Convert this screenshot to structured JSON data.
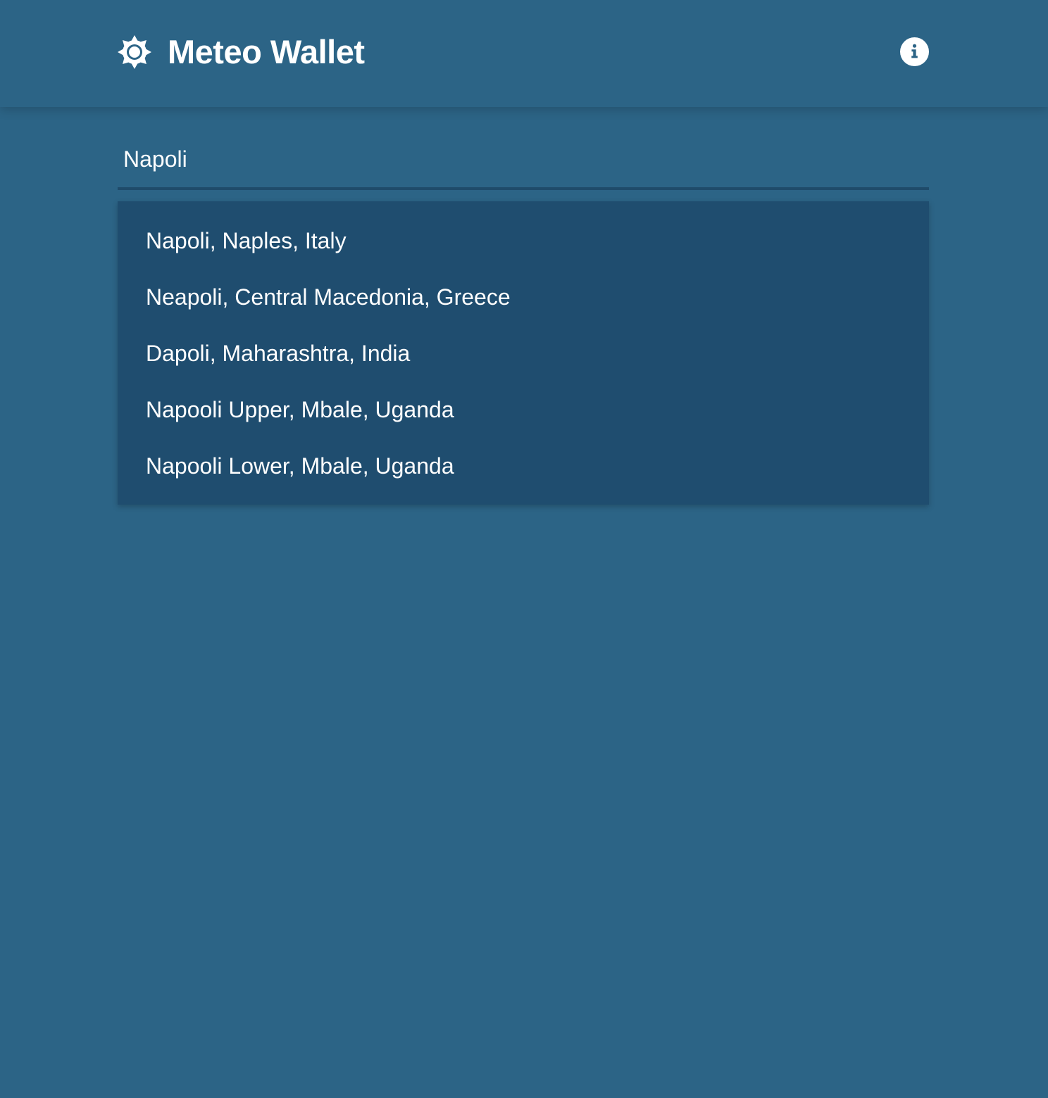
{
  "header": {
    "title": "Meteo Wallet",
    "logo_icon": "sun-icon",
    "info_icon": "info-icon"
  },
  "search": {
    "value": "Napoli",
    "placeholder": ""
  },
  "suggestions": [
    "Napoli, Naples, Italy",
    "Neapoli, Central Macedonia, Greece",
    "Dapoli, Maharashtra, India",
    "Napooli Upper, Mbale, Uganda",
    "Napooli Lower, Mbale, Uganda"
  ],
  "colors": {
    "background": "#2c6486",
    "dropdown": "#1f4d6f",
    "underline": "#1f4b6a",
    "text": "#ffffff"
  }
}
